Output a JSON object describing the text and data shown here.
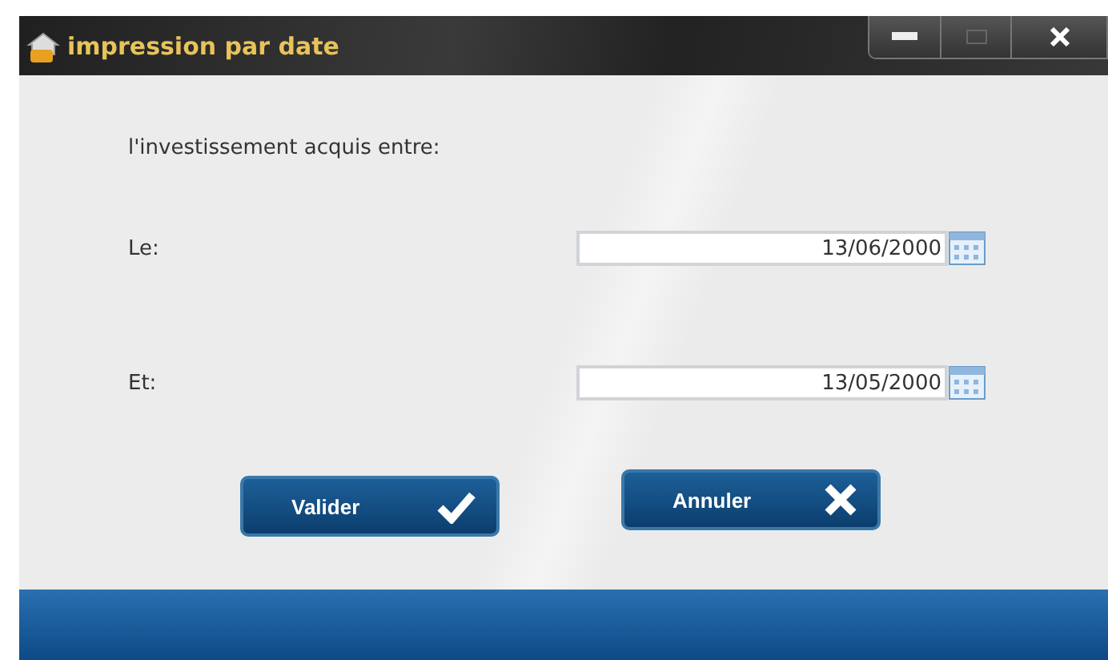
{
  "window": {
    "title": "impression par date"
  },
  "prompt": "l'investissement acquis entre:",
  "fields": [
    {
      "label": "Le:",
      "value": "13/06/2000"
    },
    {
      "label": "Et:",
      "value": "13/05/2000"
    }
  ],
  "buttons": [
    {
      "label": "Valider",
      "kind": "confirm"
    },
    {
      "label": "Annuler",
      "kind": "cancel"
    }
  ]
}
